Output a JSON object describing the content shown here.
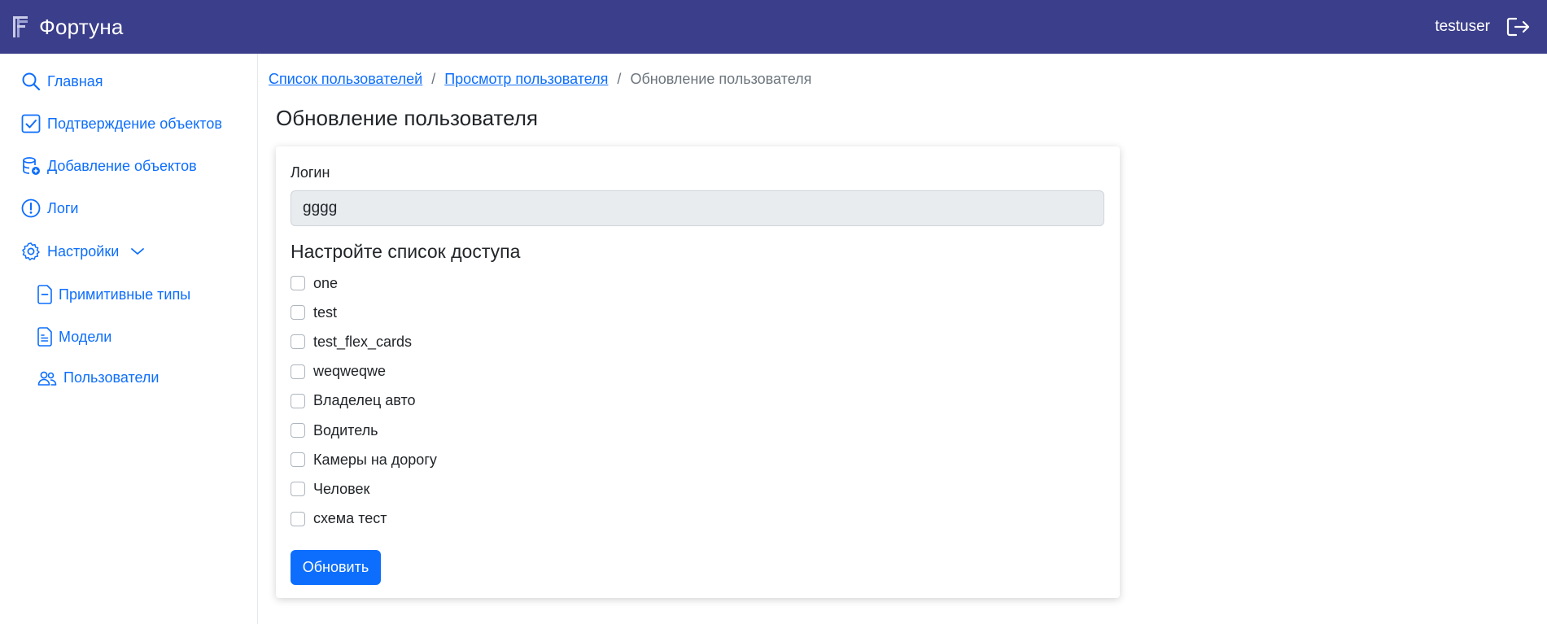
{
  "navbar": {
    "brand": "Фортуна",
    "brand_icon": "fortuna-logo-icon",
    "username": "testuser",
    "logout_icon": "logout-icon"
  },
  "sidebar": {
    "items": [
      {
        "label": "Главная",
        "icon": "search-icon"
      },
      {
        "label": "Подтверждение объектов",
        "icon": "check-square-icon"
      },
      {
        "label": "Добавление объектов",
        "icon": "database-add-icon"
      },
      {
        "label": "Логи",
        "icon": "exclamation-circle-icon"
      },
      {
        "label": "Настройки",
        "icon": "gear-icon",
        "expanded": true
      }
    ],
    "subitems": [
      {
        "label": "Примитивные типы",
        "icon": "file-minus-icon"
      },
      {
        "label": "Модели",
        "icon": "file-text-icon"
      },
      {
        "label": "Пользователи",
        "icon": "people-icon"
      }
    ]
  },
  "breadcrumb": {
    "items": [
      {
        "label": "Список пользователей"
      },
      {
        "label": "Просмотр пользователя"
      }
    ],
    "separator": "/",
    "current": "Обновление пользователя"
  },
  "page": {
    "title": "Обновление пользователя"
  },
  "form": {
    "login_label": "Логин",
    "login_value": "gggg",
    "access_title": "Настройте список доступа",
    "access_items": [
      {
        "label": "one",
        "checked": false
      },
      {
        "label": "test",
        "checked": false
      },
      {
        "label": "test_flex_cards",
        "checked": false
      },
      {
        "label": "weqweqwe",
        "checked": false
      },
      {
        "label": "Владелец авто",
        "checked": false
      },
      {
        "label": "Водитель",
        "checked": false
      },
      {
        "label": "Камеры на дорогу",
        "checked": false
      },
      {
        "label": "Человек",
        "checked": false
      },
      {
        "label": "схема тест",
        "checked": false
      }
    ],
    "submit_label": "Обновить"
  },
  "colors": {
    "navbar": "#3b3e8a",
    "link": "#0d6efd",
    "primary_button": "#0d6efd",
    "readonly_input": "#e9ecef"
  }
}
